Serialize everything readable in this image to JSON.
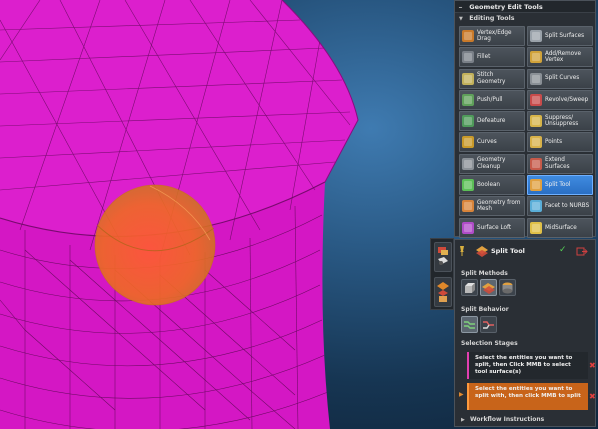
{
  "geometry_panel": {
    "title": "Geometry Edit Tools",
    "section_title": "Editing Tools",
    "tools": [
      {
        "label": "Vertex/Edge Drag",
        "icon": "vertex-drag-icon",
        "color": "#c97a2a"
      },
      {
        "label": "Split Surfaces",
        "icon": "split-surfaces-icon",
        "color": "#9aa2aa"
      },
      {
        "label": "Fillet",
        "icon": "fillet-icon",
        "color": "#7a8088"
      },
      {
        "label": "Add/Remove Vertex",
        "icon": "add-remove-vertex-icon",
        "color": "#d0a23a"
      },
      {
        "label": "Stitch Geometry",
        "icon": "stitch-geometry-icon",
        "color": "#c2b15b"
      },
      {
        "label": "Split Curves",
        "icon": "split-curves-icon",
        "color": "#8a9096"
      },
      {
        "label": "Push/Pull",
        "icon": "push-pull-icon",
        "color": "#5fa05a"
      },
      {
        "label": "Revolve/Sweep",
        "icon": "revolve-sweep-icon",
        "color": "#c84b4b"
      },
      {
        "label": "Defeature",
        "icon": "defeature-icon",
        "color": "#4f9a5a"
      },
      {
        "label": "Suppress/ Unsuppress",
        "icon": "suppress-icon",
        "color": "#d6b44a"
      },
      {
        "label": "Curves",
        "icon": "curves-icon",
        "color": "#c99a2a"
      },
      {
        "label": "Points",
        "icon": "points-icon",
        "color": "#d8b24a"
      },
      {
        "label": "Geometry Cleanup",
        "icon": "geometry-cleanup-icon",
        "color": "#8b9197"
      },
      {
        "label": "Extend Surfaces",
        "icon": "extend-surfaces-icon",
        "color": "#c65a4a"
      },
      {
        "label": "Boolean",
        "icon": "boolean-icon",
        "color": "#5cbf57"
      },
      {
        "label": "Split Tool",
        "icon": "split-tool-icon",
        "color": "#e0a040",
        "active": true
      },
      {
        "label": "Geometry from Mesh",
        "icon": "geometry-from-mesh-icon",
        "color": "#d8843a"
      },
      {
        "label": "Facet to NURBS",
        "icon": "facet-to-nurbs-icon",
        "color": "#5aaed8"
      },
      {
        "label": "Surface Loft",
        "icon": "surface-loft-icon",
        "color": "#b04cc8"
      },
      {
        "label": "MidSurface",
        "icon": "midsurface-icon",
        "color": "#e0c048"
      }
    ]
  },
  "split_panel": {
    "title": "Split Tool",
    "ok_glyph": "✓",
    "methods_label": "Split Methods",
    "behavior_label": "Split Behavior",
    "stages_label": "Selection Stages",
    "stages": [
      {
        "text": "Select the entities you want to split, then Click MMB to select tool surface(s)"
      },
      {
        "text": "Select the entities you want to split with, then click MMB to split"
      }
    ],
    "workflow_label": "Workflow Instructions"
  },
  "colors": {
    "mesh_magenta": "#d417c4",
    "sphere_orange": "#f0641f",
    "active_blue": "#2f7ad4",
    "stage_highlight": "#c8641a"
  }
}
